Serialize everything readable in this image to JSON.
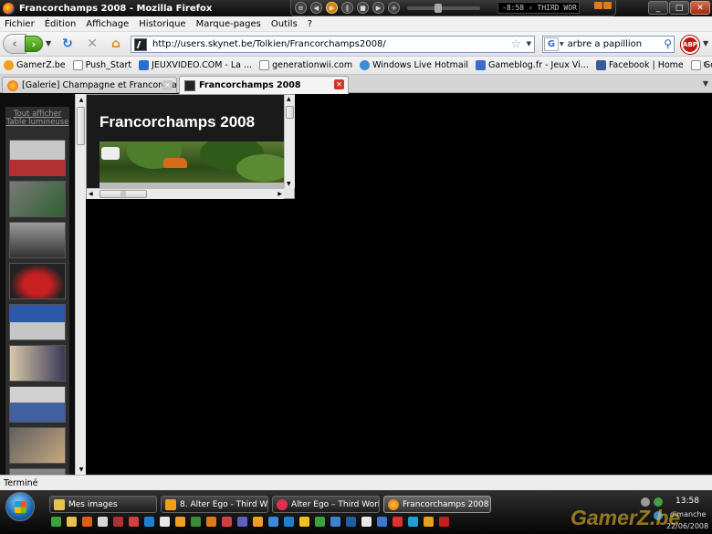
{
  "window": {
    "title": "Francorchamps 2008 - Mozilla Firefox",
    "minimize": "_",
    "maximize": "□",
    "close": "✕"
  },
  "player": {
    "display": "-8:58 › THIRD WOR"
  },
  "menu": [
    "Fichier",
    "Édition",
    "Affichage",
    "Historique",
    "Marque-pages",
    "Outils",
    "?"
  ],
  "nav": {
    "url": "http://users.skynet.be/Tolkien/Francorchamps2008/",
    "search_value": "arbre a papillion",
    "search_engine_letter": "G",
    "abp_label": "ABP",
    "icons": [
      "back-arrow-icon",
      "forward-arrow-icon",
      "reload-icon",
      "stop-icon",
      "home-icon",
      "star-icon",
      "search-icon"
    ]
  },
  "bookmarks": [
    {
      "label": "GamerZ.be",
      "color": "#f0a020"
    },
    {
      "label": "Push_Start",
      "color": "#ffffff"
    },
    {
      "label": "JEUXVIDEO.COM - La ...",
      "color": "#2a6fd0"
    },
    {
      "label": "generationwii.com",
      "color": "#ffffff"
    },
    {
      "label": "Windows Live Hotmail",
      "color": "#3c8ad8"
    },
    {
      "label": "Gameblog.fr - Jeux Vi...",
      "color": "#3a6cc8"
    },
    {
      "label": "Facebook | Home",
      "color": "#3b5998"
    },
    {
      "label": "Google Traduction",
      "color": "#ffffff"
    }
  ],
  "tabs": [
    {
      "label": "[Galerie] Champagne et Francorchamp...",
      "active": false
    },
    {
      "label": "Francorchamps 2008",
      "active": true
    }
  ],
  "gallery": {
    "link": "Tout afficher Table lumineuse",
    "thumb_colors": [
      [
        "#c8c8c8",
        "#b23030"
      ],
      [
        "#7a7a7a",
        "#2f5f2f"
      ],
      [
        "#9a9a9a",
        "#333333"
      ],
      [
        "#c62020",
        "#222222"
      ],
      [
        "#2b58a8",
        "#c6c6c6"
      ],
      [
        "#d8c8a8",
        "#3a3a5a"
      ],
      [
        "#d0d0d0",
        "#4060a0"
      ],
      [
        "#606060",
        "#c8a880"
      ],
      [
        "#8a8a8a",
        "#444444"
      ]
    ]
  },
  "page": {
    "heading": "Francorchamps 2008"
  },
  "status": "Terminé",
  "taskbar": {
    "tasks": [
      {
        "label": "Mes images",
        "color": "#e8c050"
      },
      {
        "label": "8. Alter Ego - Third W...",
        "color": "#f0a020"
      },
      {
        "label": "Alter Ego – Third Worl...",
        "color": "#e03050"
      },
      {
        "label": "Francorchamps 2008 - ...",
        "color": "#e25c12"
      }
    ],
    "time": "13:58",
    "day": "dimanche",
    "date": "22/06/2008",
    "quick_colors": [
      "#3fa03f",
      "#e8c050",
      "#e25c12",
      "#d8d8d8",
      "#b03030",
      "#d04040",
      "#2080d0",
      "#e8e8e8",
      "#f0a020",
      "#3a8a3a",
      "#e07b1a",
      "#d04040",
      "#6060c0",
      "#f0a020",
      "#3c8ad8",
      "#2080d0",
      "#f0c020",
      "#3fa03f",
      "#4080d0",
      "#2060a0",
      "#e8e8e8",
      "#3c7ad0",
      "#e03030",
      "#20a0d0",
      "#e8a020",
      "#c02020"
    ]
  },
  "watermark": "GamerZ.be"
}
